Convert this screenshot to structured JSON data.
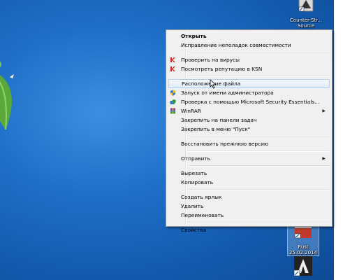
{
  "desktop_icons": [
    {
      "label": "Counter-Str... Source",
      "icon": "counter-strike-icon"
    },
    {
      "label": "Rust 25.02.2014",
      "icon": "rust-shortcut-icon"
    },
    {
      "label": "",
      "icon": "assassins-creed-icon"
    }
  ],
  "menu": {
    "items": [
      {
        "label": "Открыть",
        "bold": true,
        "icon": ""
      },
      {
        "label": "Исправление неполадок совместимости",
        "icon": ""
      },
      {
        "sep": true
      },
      {
        "label": "Проверить на вирусы",
        "icon": "kaspersky-icon"
      },
      {
        "label": "Посмотреть репутацию в KSN",
        "icon": "kaspersky-icon"
      },
      {
        "sep": true
      },
      {
        "label": "Расположение файла",
        "icon": "",
        "highlighted": true
      },
      {
        "label": "Запуск от имени администратора",
        "icon": "uac-shield-icon"
      },
      {
        "label": "Проверка с помощью Microsoft Security Essentials...",
        "icon": "security-essentials-icon"
      },
      {
        "label": "WinRAR",
        "icon": "winrar-icon",
        "submenu": true
      },
      {
        "label": "Закрепить на панели задач",
        "icon": ""
      },
      {
        "label": "Закрепить в меню \"Пуск\"",
        "icon": ""
      },
      {
        "sep": true
      },
      {
        "label": "Восстановить прежнюю версию",
        "icon": ""
      },
      {
        "sep": true
      },
      {
        "label": "Отправить",
        "icon": "",
        "submenu": true
      },
      {
        "sep": true
      },
      {
        "label": "Вырезать",
        "icon": ""
      },
      {
        "label": "Копировать",
        "icon": ""
      },
      {
        "sep": true
      },
      {
        "label": "Создать ярлык",
        "icon": ""
      },
      {
        "label": "Удалить",
        "icon": ""
      },
      {
        "label": "Переименовать",
        "icon": ""
      },
      {
        "sep": true
      },
      {
        "label": "Свойства",
        "icon": ""
      }
    ]
  },
  "colors": {
    "desktop_blue": "#1f6fc8",
    "menu_bg": "#f0f0f0",
    "highlight_border": "#aecff7",
    "kaspersky_red": "#d8222a"
  }
}
